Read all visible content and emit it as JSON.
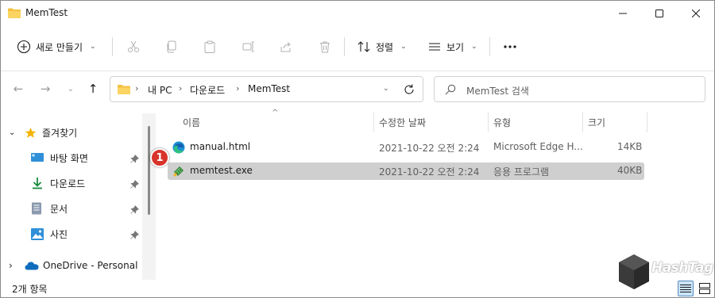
{
  "window": {
    "title": "MemTest"
  },
  "commandbar": {
    "new_label": "새로 만들기",
    "sort_label": "정렬",
    "view_label": "보기"
  },
  "address": {
    "crumbs": [
      "내 PC",
      "다운로드",
      "MemTest"
    ]
  },
  "search": {
    "placeholder": "MemTest 검색"
  },
  "navpane": {
    "quick_access": "즐겨찾기",
    "items": [
      {
        "label": "바탕 화면",
        "icon": "desktop-icon"
      },
      {
        "label": "다운로드",
        "icon": "download-icon"
      },
      {
        "label": "문서",
        "icon": "document-icon"
      },
      {
        "label": "사진",
        "icon": "picture-icon"
      }
    ],
    "onedrive": "OneDrive - Personal"
  },
  "columns": {
    "name": "이름",
    "modified": "수정한 날짜",
    "type": "유형",
    "size": "크기"
  },
  "files": [
    {
      "name": "manual.html",
      "modified": "2021-10-22 오전 2:24",
      "type": "Microsoft Edge H...",
      "size": "14KB",
      "icon": "edge-icon"
    },
    {
      "name": "memtest.exe",
      "modified": "2021-10-22 오전 2:24",
      "type": "응용 프로그램",
      "size": "40KB",
      "icon": "exe-icon"
    }
  ],
  "annotation": {
    "badge": "1"
  },
  "status": {
    "count": "2개 항목"
  },
  "watermark": {
    "text": "HashTag"
  },
  "colors": {
    "selection": "#cfcfcf",
    "folder": "#f3c041",
    "accent": "#0067c0",
    "badge": "#d8342b"
  }
}
